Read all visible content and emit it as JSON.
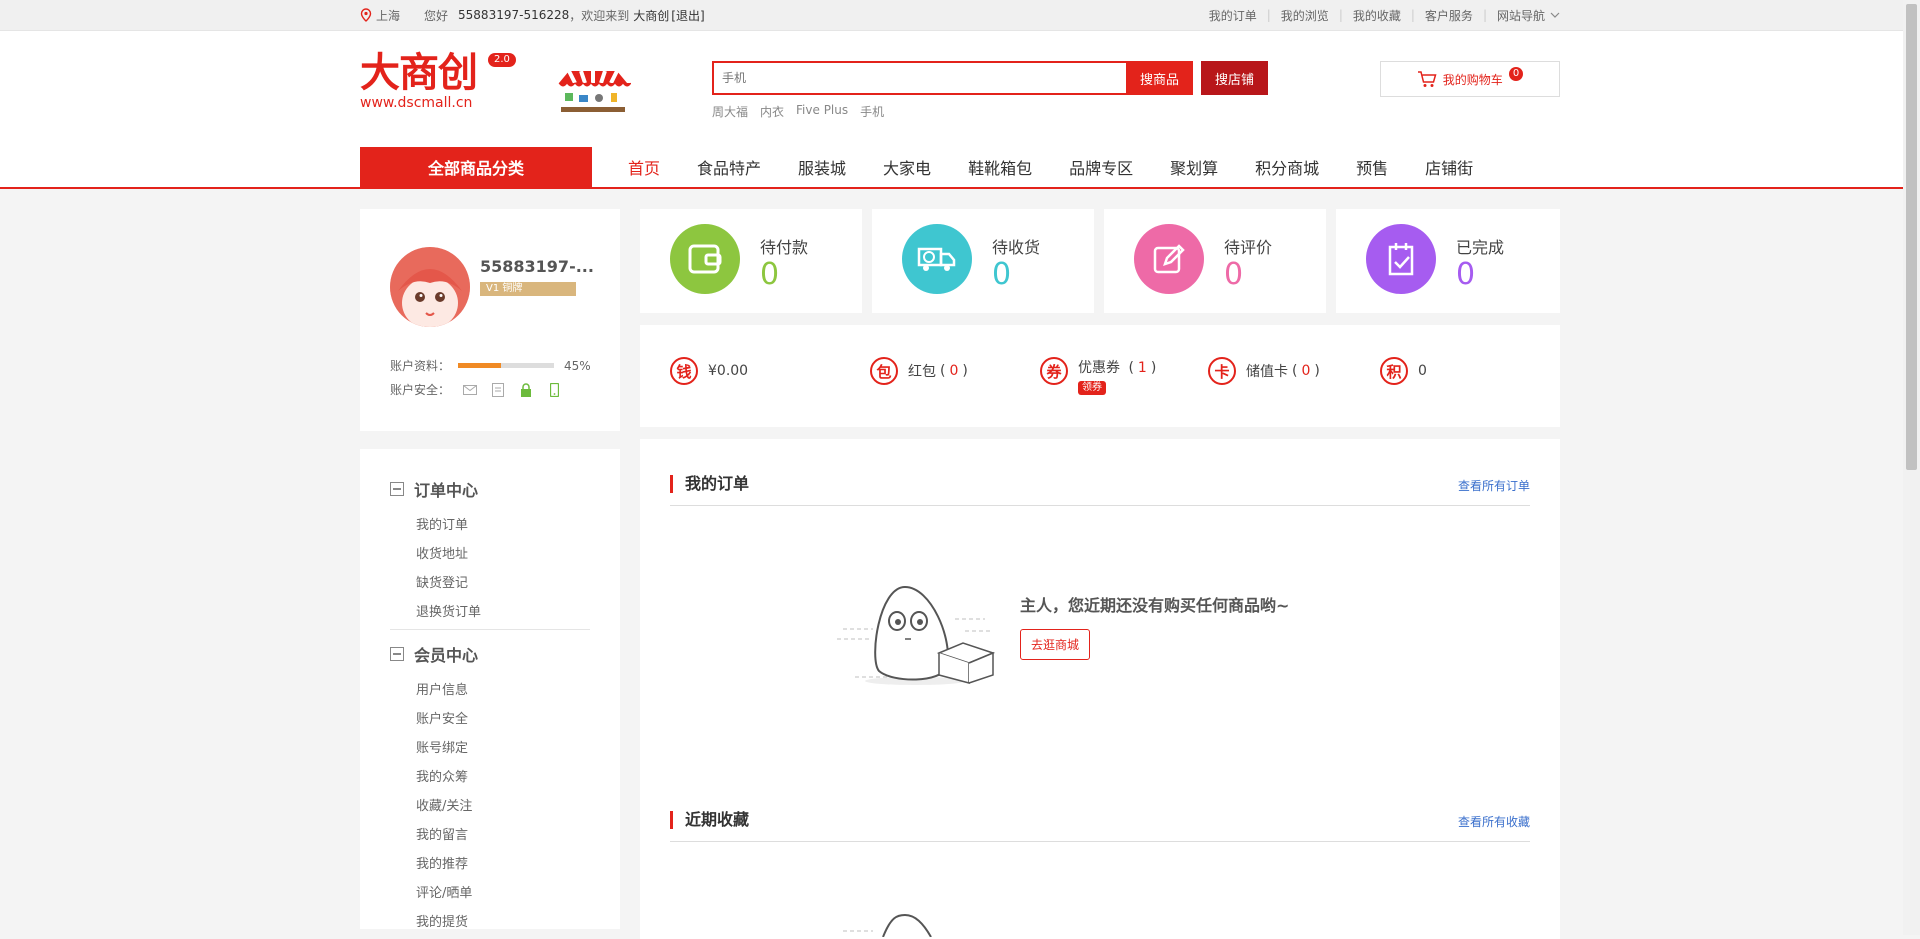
{
  "topbar": {
    "location": "上海",
    "greeting": "您好",
    "user_id": "55883197-516228",
    "welcome": "，欢迎来到",
    "site_name": "大商创",
    "logout": "[退出]",
    "links": [
      "我的订单",
      "我的浏览",
      "我的收藏",
      "客户服务",
      "网站导航"
    ]
  },
  "logo": {
    "name": "大商创",
    "version": "2.0",
    "url": "www.dscmall.cn"
  },
  "search": {
    "placeholder": "手机",
    "btn_goods": "搜商品",
    "btn_shop": "搜店铺",
    "hot": [
      "周大福",
      "内衣",
      "Five Plus",
      "手机"
    ]
  },
  "cart": {
    "label": "我的购物车",
    "count": "0"
  },
  "nav": {
    "all_categories": "全部商品分类",
    "items": [
      "首页",
      "食品特产",
      "服装城",
      "大家电",
      "鞋靴箱包",
      "品牌专区",
      "聚划算",
      "积分商城",
      "预售",
      "店铺街"
    ]
  },
  "user": {
    "name": "55883197-...",
    "rank": "V1 铜牌",
    "profile_label": "账户资料：",
    "profile_percent": "45%",
    "profile_progress": 0.45,
    "security_label": "账户安全："
  },
  "menu": {
    "groups": [
      {
        "title": "订单中心",
        "items": [
          "我的订单",
          "收货地址",
          "缺货登记",
          "退换货订单"
        ]
      },
      {
        "title": "会员中心",
        "items": [
          "用户信息",
          "账户安全",
          "账号绑定",
          "我的众筹",
          "收藏/关注",
          "我的留言",
          "我的推荐",
          "评论/晒单",
          "我的提货"
        ]
      }
    ]
  },
  "stats": [
    {
      "label": "待付款",
      "value": "0",
      "color": "#8dc63f"
    },
    {
      "label": "待收货",
      "value": "0",
      "color": "#3fc6d0"
    },
    {
      "label": "待评价",
      "value": "0",
      "color": "#ee6aa7"
    },
    {
      "label": "已完成",
      "value": "0",
      "color": "#a65cf0"
    }
  ],
  "assets": [
    {
      "icon": "钱",
      "label": "¥0.00"
    },
    {
      "icon": "包",
      "label": "红包",
      "count": "0"
    },
    {
      "icon": "券",
      "label": "优惠券",
      "count": "1",
      "tag": "领券"
    },
    {
      "icon": "卡",
      "label": "储值卡",
      "count": "0"
    },
    {
      "icon": "积",
      "label": "0"
    }
  ],
  "orders": {
    "title": "我的订单",
    "more": "查看所有订单",
    "empty_msg": "主人，您近期还没有购买任何商品哟~",
    "go_btn": "去逛商城"
  },
  "favorites": {
    "title": "近期收藏",
    "more": "查看所有收藏"
  },
  "colors": {
    "accent": "#e3231b",
    "link": "#3a6fcc"
  }
}
